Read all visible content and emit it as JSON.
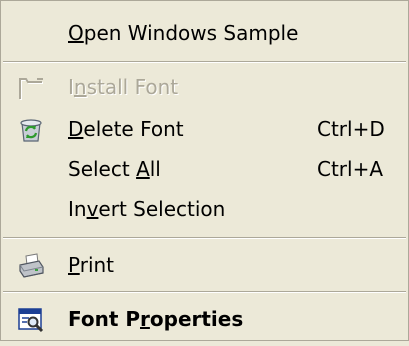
{
  "menu": {
    "items": [
      {
        "id": "open-windows-sample",
        "pre": "",
        "mn": "O",
        "post": "pen Windows Sample",
        "shortcut": "",
        "icon": "",
        "enabled": true,
        "bold": false
      },
      {
        "id": "install-font",
        "pre": "I",
        "mn": "n",
        "post": "stall Font",
        "shortcut": "",
        "icon": "folder-outline-icon",
        "enabled": false,
        "bold": false
      },
      {
        "id": "delete-font",
        "pre": "",
        "mn": "D",
        "post": "elete Font",
        "shortcut": "Ctrl+D",
        "icon": "recycle-bin-icon",
        "enabled": true,
        "bold": false
      },
      {
        "id": "select-all",
        "pre": "Select ",
        "mn": "A",
        "post": "ll",
        "shortcut": "Ctrl+A",
        "icon": "",
        "enabled": true,
        "bold": false
      },
      {
        "id": "invert-selection",
        "pre": "In",
        "mn": "v",
        "post": "ert Selection",
        "shortcut": "",
        "icon": "",
        "enabled": true,
        "bold": false
      },
      {
        "id": "print",
        "pre": "",
        "mn": "P",
        "post": "rint",
        "shortcut": "",
        "icon": "printer-icon",
        "enabled": true,
        "bold": false
      },
      {
        "id": "font-properties",
        "pre": "Font P",
        "mn": "r",
        "post": "operties",
        "shortcut": "",
        "icon": "properties-icon",
        "enabled": true,
        "bold": true
      }
    ]
  },
  "colors": {
    "background": "#ece9d8",
    "separator": "#aca899",
    "disabled_text": "#aca899"
  }
}
